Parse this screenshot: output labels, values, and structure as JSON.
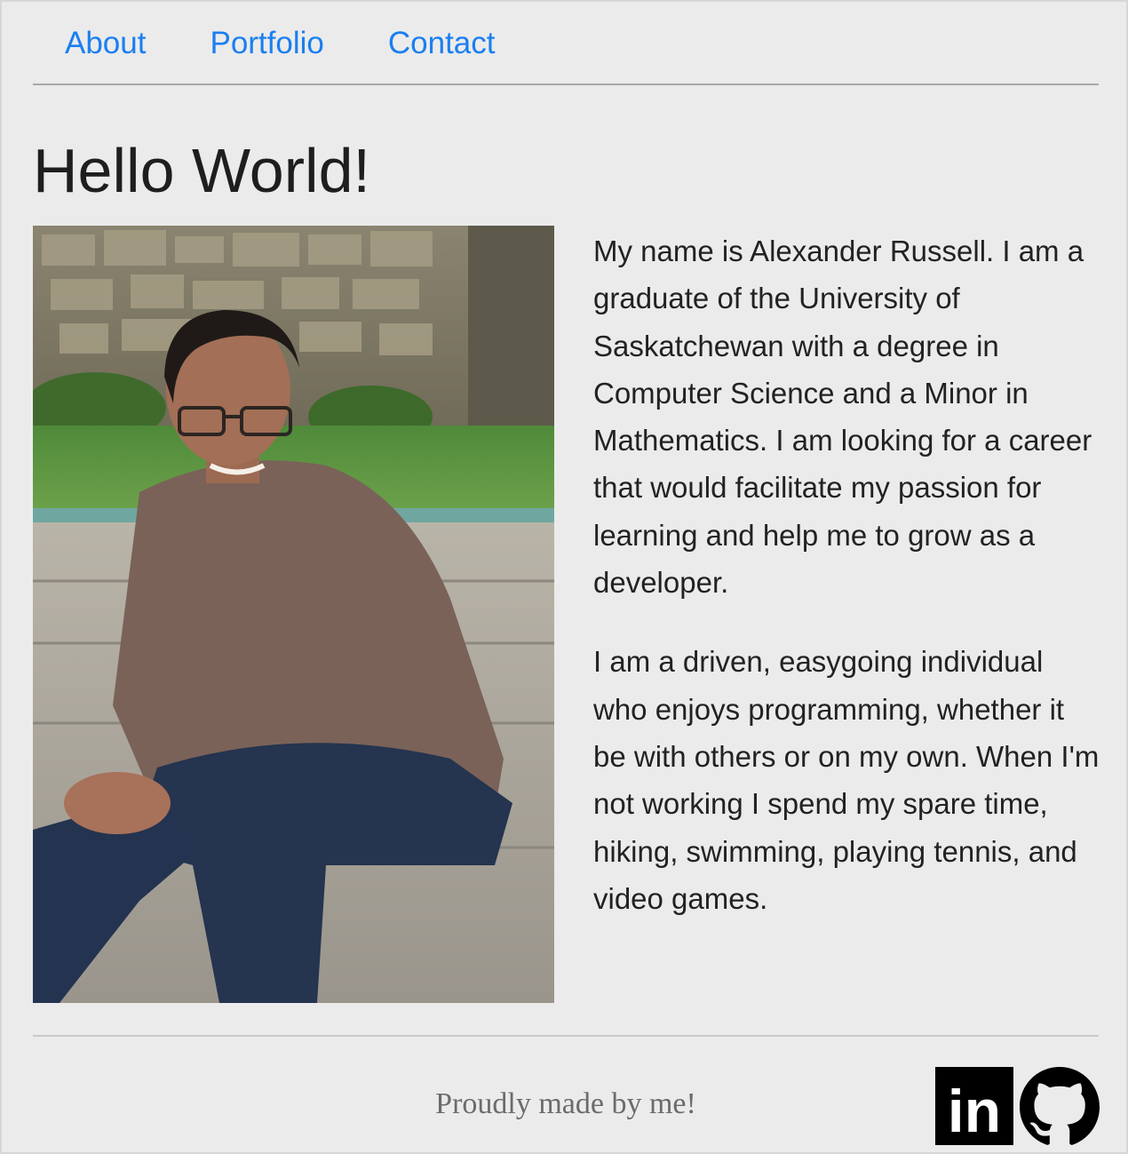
{
  "nav": {
    "items": [
      {
        "label": "About"
      },
      {
        "label": "Portfolio"
      },
      {
        "label": "Contact"
      }
    ]
  },
  "main": {
    "title": "Hello World!",
    "bio": [
      "My name is Alexander Russell. I am a graduate of the University of Saskatchewan with a degree in Computer Science and a Minor in Mathematics. I am looking for a career that would facilitate my passion for learning and help me to grow as a developer.",
      "I am a driven, easygoing individual who enjoys programming, whether it be with others or on my own. When I'm not working I spend my spare time, hiking, swimming, playing tennis, and video games."
    ]
  },
  "footer": {
    "text": "Proudly made by me!",
    "links": [
      {
        "icon": "linkedin-icon",
        "logo_text": "in"
      },
      {
        "icon": "github-icon"
      }
    ]
  },
  "colors": {
    "background": "#ebebeb",
    "link": "#1a7ff0",
    "text": "#212529",
    "footer_text": "#6b6b6b"
  }
}
